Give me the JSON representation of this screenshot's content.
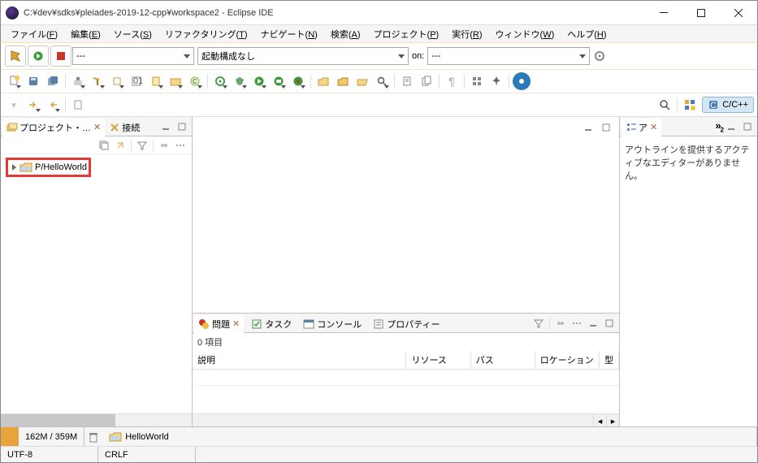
{
  "window": {
    "title": "C:¥dev¥sdks¥pleiades-2019-12-cpp¥workspace2 - Eclipse IDE"
  },
  "menu": {
    "items": [
      {
        "label": "ファイル",
        "accel": "F"
      },
      {
        "label": "編集",
        "accel": "E"
      },
      {
        "label": "ソース",
        "accel": "S"
      },
      {
        "label": "リファクタリング",
        "accel": "T"
      },
      {
        "label": "ナビゲート",
        "accel": "N"
      },
      {
        "label": "検索",
        "accel": "A"
      },
      {
        "label": "プロジェクト",
        "accel": "P"
      },
      {
        "label": "実行",
        "accel": "R"
      },
      {
        "label": "ウィンドウ",
        "accel": "W"
      },
      {
        "label": "ヘルプ",
        "accel": "H"
      }
    ]
  },
  "toolbar1": {
    "launch_select1": "---",
    "launch_select2": "起動構成なし",
    "on_label": "on:",
    "on_select": "---"
  },
  "perspective": {
    "label": "C/C++"
  },
  "left_view": {
    "tabs": [
      {
        "label": "プロジェクト・…",
        "active": true
      },
      {
        "label": "接続",
        "active": false
      }
    ],
    "tree": [
      {
        "label": "P/HelloWorld"
      }
    ]
  },
  "right_view": {
    "tab_label": "ア",
    "outline_message": "アウトラインを提供するアクティブなエディターがありません。"
  },
  "bottom_view": {
    "tabs": [
      {
        "label": "問題",
        "active": true
      },
      {
        "label": "タスク",
        "active": false
      },
      {
        "label": "コンソール",
        "active": false
      },
      {
        "label": "プロパティー",
        "active": false
      }
    ],
    "count_label": "0 項目",
    "columns": [
      "説明",
      "リソース",
      "パス",
      "ロケーション",
      "型"
    ]
  },
  "status": {
    "memory": "162M / 359M",
    "breadcrumb": "HelloWorld",
    "encoding": "UTF-8",
    "line_ending": "CRLF"
  }
}
